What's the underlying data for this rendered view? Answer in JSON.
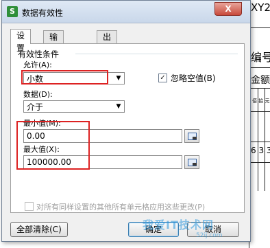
{
  "sheet": {
    "frag1": "XY2",
    "frag2": "编号",
    "frag3": "金额",
    "frag4": "佰 拾 元",
    "frag5": "6 3 3"
  },
  "dialog": {
    "app_icon": "S",
    "title": "数据有效性",
    "close": "X",
    "tabs": [
      "设置",
      "输入信息",
      "出错警告"
    ],
    "group_label": "有效性条件",
    "allow_label": "允许(A):",
    "allow_value": "小数",
    "ignore_blank_label": "忽略空值(B)",
    "ignore_blank_checked": true,
    "data_label": "数据(D):",
    "data_value": "介于",
    "min_label": "最小值(M):",
    "min_value": "0.00",
    "max_label": "最大值(X):",
    "max_value": "100000.00",
    "apply_all_label": "对所有同样设置的其他所有单元格应用这些更改(P)",
    "clear_all": "全部清除(C)",
    "ok": "确定",
    "cancel": "取消"
  },
  "watermark": {
    "text": "我爱IT技术网",
    "url": "52ij.com"
  },
  "colors": {
    "highlight": "#dd2222",
    "title_bar": "#c9d7ea"
  }
}
